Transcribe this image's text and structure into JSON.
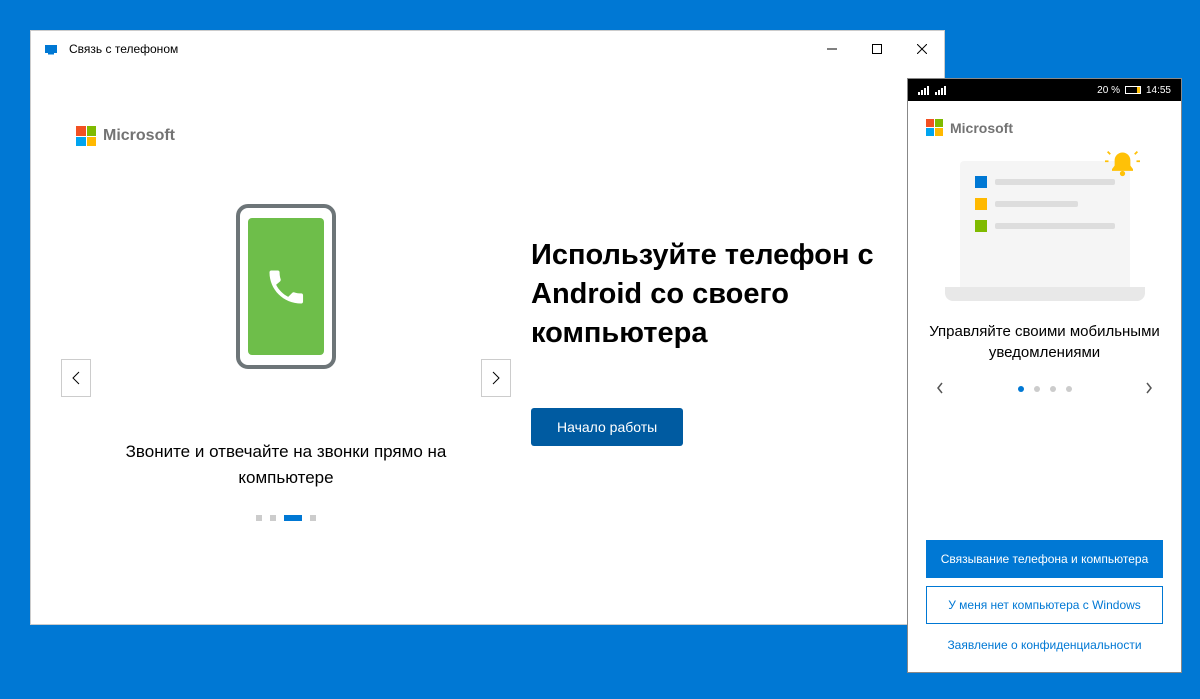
{
  "desktop": {
    "titlebar": {
      "title": "Связь с телефоном"
    },
    "brand": "Microsoft",
    "carousel": {
      "caption": "Звоните и отвечайте на звонки прямо на компьютере",
      "active_index": 2,
      "total": 4
    },
    "hero": {
      "title": "Используйте телефон с Android со своего компьютера",
      "cta": "Начало работы"
    }
  },
  "phone": {
    "statusbar": {
      "battery_pct": "20 %",
      "time": "14:55"
    },
    "brand": "Microsoft",
    "carousel": {
      "caption": "Управляйте своими мобильными уведомлениями",
      "active_index": 0,
      "total": 4
    },
    "buttons": {
      "primary": "Связывание телефона и компьютера",
      "secondary": "У меня нет компьютера с Windows",
      "privacy": "Заявление о конфиденциальности"
    }
  }
}
